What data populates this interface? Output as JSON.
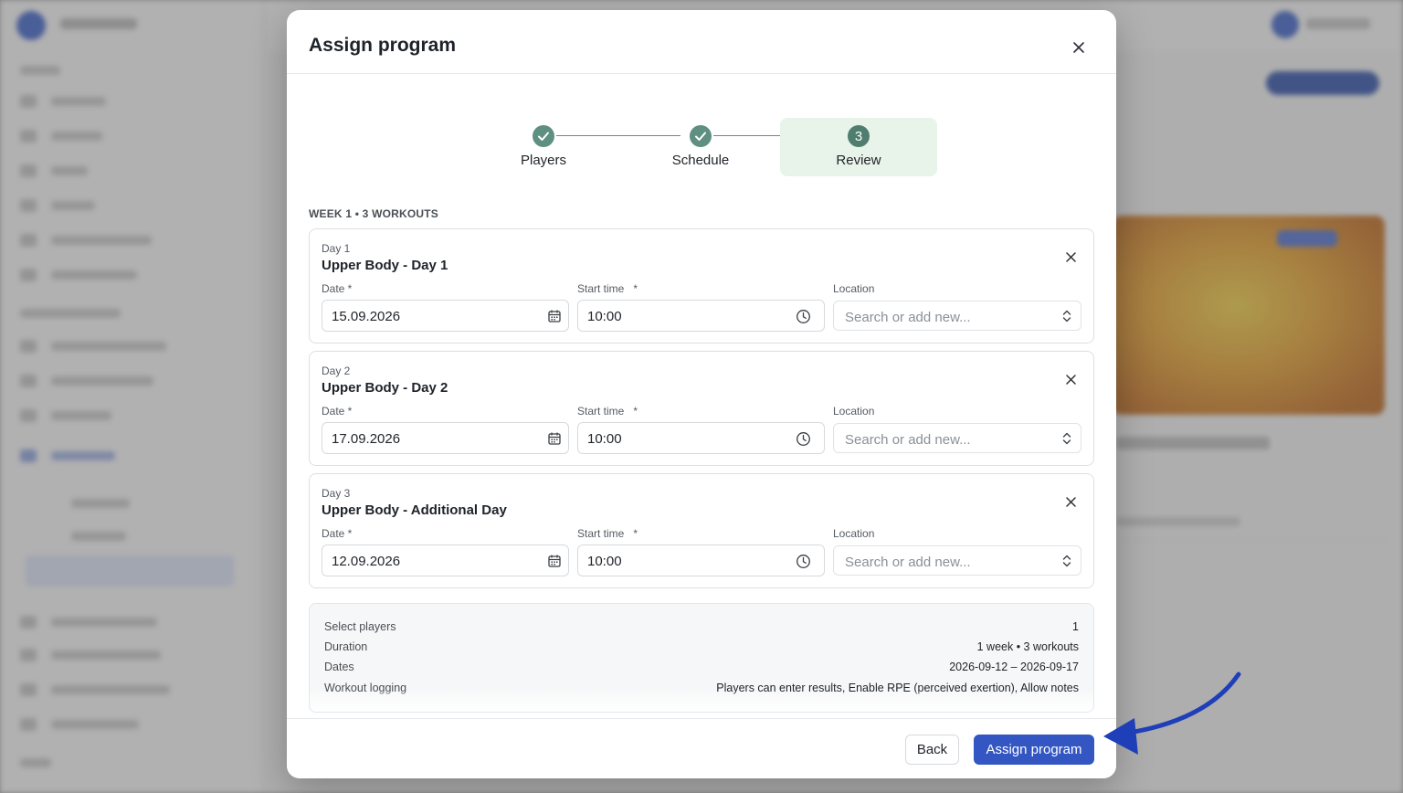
{
  "modal": {
    "title": "Assign program",
    "close_icon": "close-icon"
  },
  "stepper": {
    "steps": [
      {
        "label": "Players",
        "state": "completed",
        "icon": "check-icon"
      },
      {
        "label": "Schedule",
        "state": "completed",
        "icon": "check-icon"
      },
      {
        "label": "Review",
        "state": "active",
        "number": "3"
      }
    ]
  },
  "week_heading": "WEEK 1 • 3 WORKOUTS",
  "labels": {
    "date": "Date *",
    "start_time": "Start time",
    "start_time_required": "*",
    "location": "Location"
  },
  "days": [
    {
      "day": "Day 1",
      "title": "Upper Body - Day 1",
      "date": "15.09.2026",
      "start_time": "10:00",
      "location_placeholder": "Search or add new..."
    },
    {
      "day": "Day 2",
      "title": "Upper Body - Day 2",
      "date": "17.09.2026",
      "start_time": "10:00",
      "location_placeholder": "Search or add new..."
    },
    {
      "day": "Day 3",
      "title": "Upper Body - Additional Day",
      "date": "12.09.2026",
      "start_time": "10:00",
      "location_placeholder": "Search or add new..."
    }
  ],
  "summary": {
    "rows": [
      {
        "key": "Select players",
        "value": "1"
      },
      {
        "key": "Duration",
        "value": "1 week • 3 workouts"
      },
      {
        "key": "Dates",
        "value": "2026-09-12 – 2026-09-17"
      },
      {
        "key": "Workout logging",
        "value": "Players can enter results, Enable RPE (perceived exertion), Allow notes"
      }
    ]
  },
  "footer": {
    "back_label": "Back",
    "assign_label": "Assign program"
  },
  "colors": {
    "primary": "#3356c2",
    "step_green": "#5f8f80",
    "step_active_bg": "#e8f3e9",
    "annotation_arrow": "#1f3fb8"
  }
}
